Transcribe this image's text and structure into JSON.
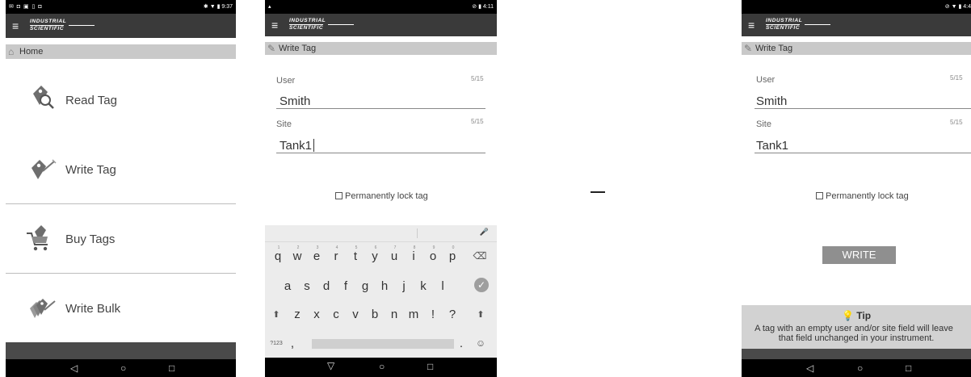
{
  "brand": {
    "line1": "INDUSTRIAL",
    "line2": "SCIENTIFIC"
  },
  "nav": {
    "back": "◁",
    "home": "○",
    "recents": "□"
  },
  "home": {
    "status_left": "✉ ◘ ▣ ▯ ◘",
    "status_right": "✱ ▼ ▮ 9:37",
    "header": "Home",
    "items": [
      {
        "label": "Read Tag",
        "icon": "read-tag-icon"
      },
      {
        "label": "Write Tag",
        "icon": "write-tag-icon"
      },
      {
        "label": "Buy Tags",
        "icon": "buy-tags-icon"
      },
      {
        "label": "Write Bulk",
        "icon": "write-bulk-icon"
      }
    ]
  },
  "write_keyboard": {
    "status_left": "▴",
    "status_right": "⊘ ▮ 4:11",
    "header": "Write Tag",
    "user_label": "User",
    "user_value": "Smith",
    "user_count": "5/15",
    "site_label": "Site",
    "site_value": "Tank1",
    "site_count": "5/15",
    "lock_label": "Permanently lock tag",
    "keyboard": {
      "row1": [
        "q",
        "w",
        "e",
        "r",
        "t",
        "y",
        "u",
        "i",
        "o",
        "p"
      ],
      "row1_hints": [
        "1",
        "2",
        "3",
        "4",
        "5",
        "6",
        "7",
        "8",
        "9",
        "0"
      ],
      "row2": [
        "a",
        "s",
        "d",
        "f",
        "g",
        "h",
        "j",
        "k",
        "l"
      ],
      "row3": [
        "z",
        "x",
        "c",
        "v",
        "b",
        "n",
        "m",
        "!",
        "?"
      ],
      "mic": "🎤",
      "backspace": "⌫",
      "enter": "✓",
      "shift": "⬆",
      "symbols": "?123",
      "comma": ",",
      "period": ".",
      "emoji": "☺"
    }
  },
  "write_final": {
    "status_right": "⊘ ▼ ▮ 4:4",
    "header": "Write Tag",
    "user_label": "User",
    "user_value": "Smith",
    "user_count": "5/15",
    "site_label": "Site",
    "site_value": "Tank1",
    "site_count": "5/15",
    "lock_label": "Permanently lock tag",
    "write_button": "WRITE",
    "tip_title": "Tip",
    "tip_text_1": "A tag with an empty user and/or site field will leave",
    "tip_text_2": "that field unchanged in your instrument."
  },
  "colors": {
    "appbar": "#3a3a3a",
    "subheader": "#c9c9c9",
    "button": "#8f8f8f",
    "tip_bg": "#d2d2d2"
  }
}
